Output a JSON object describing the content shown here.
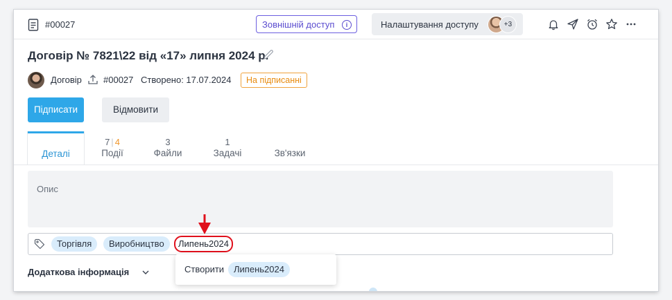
{
  "topbar": {
    "doc_id": "#00027",
    "external_access": "Зовнішній доступ",
    "info_glyph": "i",
    "access_settings": "Налаштування доступу",
    "extra_count": "+3",
    "icons": [
      "bell-icon",
      "send-icon",
      "alarm-clock-icon",
      "star-icon",
      "more-icon"
    ]
  },
  "document": {
    "title": "Договір № 7821\\22 від «17» липня 2024 р.",
    "type": "Договір",
    "id": "#00027",
    "created": "Створено: 17.07.2024",
    "status": "На підписанні"
  },
  "actions": {
    "sign": "Підписати",
    "decline": "Відмовити"
  },
  "tabs": [
    {
      "label": "Деталі",
      "count": ""
    },
    {
      "label": "Події",
      "count_a": "7",
      "count_b": "4"
    },
    {
      "label": "Файли",
      "count": "3"
    },
    {
      "label": "Задачі",
      "count": "1"
    },
    {
      "label": "Зв'язки",
      "count": ""
    }
  ],
  "description": {
    "label": "Опис"
  },
  "tags": {
    "chips": [
      "Торгівля",
      "Виробництво"
    ],
    "typed_value": "Липень2024"
  },
  "dropdown": {
    "create_label": "Створити",
    "new_tag": "Липень2024"
  },
  "extra_info": {
    "label": "Додаткова інформація"
  },
  "colors": {
    "accent": "#2ea7e8",
    "status": "#f0962b",
    "external_access": "#5a4ccf",
    "highlight": "#e0101c"
  }
}
